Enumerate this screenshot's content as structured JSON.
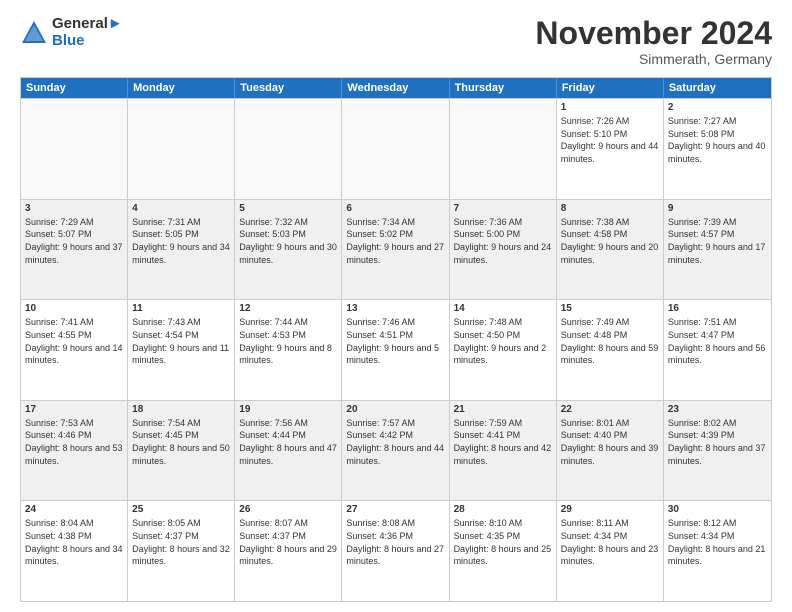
{
  "logo": {
    "line1": "General",
    "line2": "Blue"
  },
  "title": "November 2024",
  "subtitle": "Simmerath, Germany",
  "days": [
    "Sunday",
    "Monday",
    "Tuesday",
    "Wednesday",
    "Thursday",
    "Friday",
    "Saturday"
  ],
  "rows": [
    [
      {
        "day": "",
        "info": ""
      },
      {
        "day": "",
        "info": ""
      },
      {
        "day": "",
        "info": ""
      },
      {
        "day": "",
        "info": ""
      },
      {
        "day": "",
        "info": ""
      },
      {
        "day": "1",
        "info": "Sunrise: 7:26 AM\nSunset: 5:10 PM\nDaylight: 9 hours and 44 minutes."
      },
      {
        "day": "2",
        "info": "Sunrise: 7:27 AM\nSunset: 5:08 PM\nDaylight: 9 hours and 40 minutes."
      }
    ],
    [
      {
        "day": "3",
        "info": "Sunrise: 7:29 AM\nSunset: 5:07 PM\nDaylight: 9 hours and 37 minutes."
      },
      {
        "day": "4",
        "info": "Sunrise: 7:31 AM\nSunset: 5:05 PM\nDaylight: 9 hours and 34 minutes."
      },
      {
        "day": "5",
        "info": "Sunrise: 7:32 AM\nSunset: 5:03 PM\nDaylight: 9 hours and 30 minutes."
      },
      {
        "day": "6",
        "info": "Sunrise: 7:34 AM\nSunset: 5:02 PM\nDaylight: 9 hours and 27 minutes."
      },
      {
        "day": "7",
        "info": "Sunrise: 7:36 AM\nSunset: 5:00 PM\nDaylight: 9 hours and 24 minutes."
      },
      {
        "day": "8",
        "info": "Sunrise: 7:38 AM\nSunset: 4:58 PM\nDaylight: 9 hours and 20 minutes."
      },
      {
        "day": "9",
        "info": "Sunrise: 7:39 AM\nSunset: 4:57 PM\nDaylight: 9 hours and 17 minutes."
      }
    ],
    [
      {
        "day": "10",
        "info": "Sunrise: 7:41 AM\nSunset: 4:55 PM\nDaylight: 9 hours and 14 minutes."
      },
      {
        "day": "11",
        "info": "Sunrise: 7:43 AM\nSunset: 4:54 PM\nDaylight: 9 hours and 11 minutes."
      },
      {
        "day": "12",
        "info": "Sunrise: 7:44 AM\nSunset: 4:53 PM\nDaylight: 9 hours and 8 minutes."
      },
      {
        "day": "13",
        "info": "Sunrise: 7:46 AM\nSunset: 4:51 PM\nDaylight: 9 hours and 5 minutes."
      },
      {
        "day": "14",
        "info": "Sunrise: 7:48 AM\nSunset: 4:50 PM\nDaylight: 9 hours and 2 minutes."
      },
      {
        "day": "15",
        "info": "Sunrise: 7:49 AM\nSunset: 4:48 PM\nDaylight: 8 hours and 59 minutes."
      },
      {
        "day": "16",
        "info": "Sunrise: 7:51 AM\nSunset: 4:47 PM\nDaylight: 8 hours and 56 minutes."
      }
    ],
    [
      {
        "day": "17",
        "info": "Sunrise: 7:53 AM\nSunset: 4:46 PM\nDaylight: 8 hours and 53 minutes."
      },
      {
        "day": "18",
        "info": "Sunrise: 7:54 AM\nSunset: 4:45 PM\nDaylight: 8 hours and 50 minutes."
      },
      {
        "day": "19",
        "info": "Sunrise: 7:56 AM\nSunset: 4:44 PM\nDaylight: 8 hours and 47 minutes."
      },
      {
        "day": "20",
        "info": "Sunrise: 7:57 AM\nSunset: 4:42 PM\nDaylight: 8 hours and 44 minutes."
      },
      {
        "day": "21",
        "info": "Sunrise: 7:59 AM\nSunset: 4:41 PM\nDaylight: 8 hours and 42 minutes."
      },
      {
        "day": "22",
        "info": "Sunrise: 8:01 AM\nSunset: 4:40 PM\nDaylight: 8 hours and 39 minutes."
      },
      {
        "day": "23",
        "info": "Sunrise: 8:02 AM\nSunset: 4:39 PM\nDaylight: 8 hours and 37 minutes."
      }
    ],
    [
      {
        "day": "24",
        "info": "Sunrise: 8:04 AM\nSunset: 4:38 PM\nDaylight: 8 hours and 34 minutes."
      },
      {
        "day": "25",
        "info": "Sunrise: 8:05 AM\nSunset: 4:37 PM\nDaylight: 8 hours and 32 minutes."
      },
      {
        "day": "26",
        "info": "Sunrise: 8:07 AM\nSunset: 4:37 PM\nDaylight: 8 hours and 29 minutes."
      },
      {
        "day": "27",
        "info": "Sunrise: 8:08 AM\nSunset: 4:36 PM\nDaylight: 8 hours and 27 minutes."
      },
      {
        "day": "28",
        "info": "Sunrise: 8:10 AM\nSunset: 4:35 PM\nDaylight: 8 hours and 25 minutes."
      },
      {
        "day": "29",
        "info": "Sunrise: 8:11 AM\nSunset: 4:34 PM\nDaylight: 8 hours and 23 minutes."
      },
      {
        "day": "30",
        "info": "Sunrise: 8:12 AM\nSunset: 4:34 PM\nDaylight: 8 hours and 21 minutes."
      }
    ]
  ]
}
